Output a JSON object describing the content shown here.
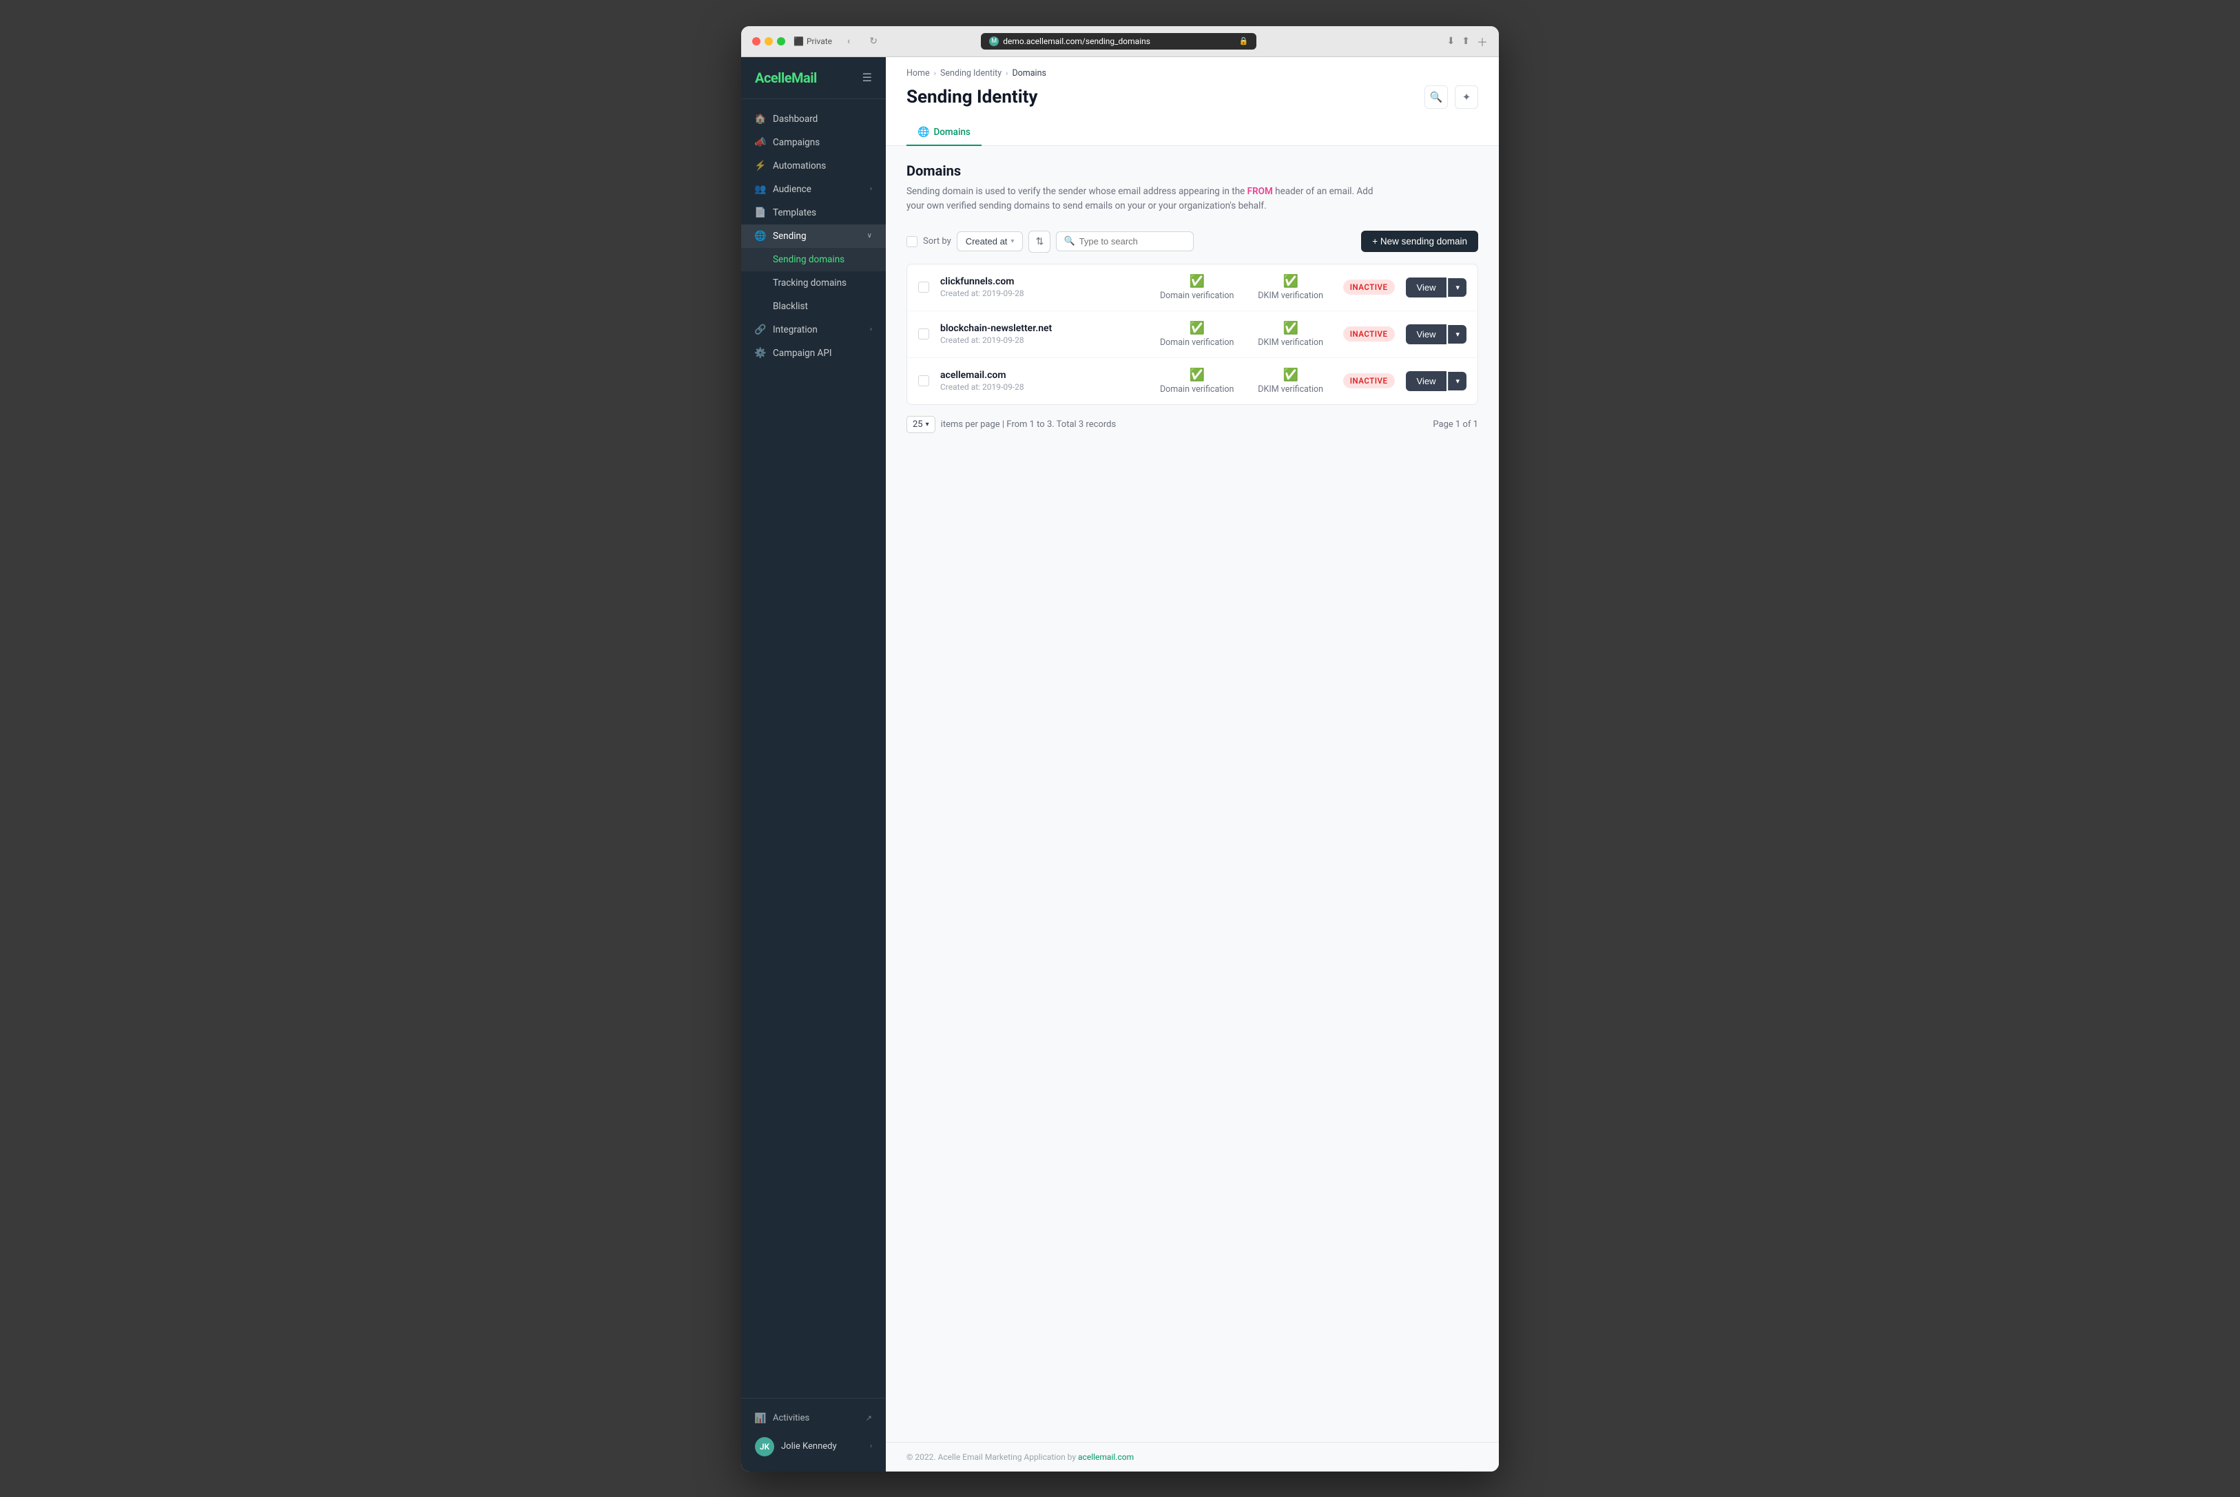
{
  "browser": {
    "url": "demo.acellemail.com/sending_domains",
    "private_label": "Private"
  },
  "logo": {
    "text1": "Acelle",
    "text2": "Mail"
  },
  "sidebar": {
    "nav_items": [
      {
        "id": "dashboard",
        "label": "Dashboard",
        "icon": "🏠",
        "active": false
      },
      {
        "id": "campaigns",
        "label": "Campaigns",
        "icon": "📣",
        "active": false
      },
      {
        "id": "automations",
        "label": "Automations",
        "icon": "⚡",
        "active": false
      },
      {
        "id": "audience",
        "label": "Audience",
        "icon": "👥",
        "active": false,
        "has_submenu": true
      },
      {
        "id": "templates",
        "label": "Templates",
        "icon": "📄",
        "active": false
      },
      {
        "id": "sending",
        "label": "Sending",
        "icon": "🌐",
        "active": true,
        "has_submenu": true
      }
    ],
    "submenu_items": [
      {
        "id": "sending-domains",
        "label": "Sending domains",
        "active": true
      },
      {
        "id": "tracking-domains",
        "label": "Tracking domains",
        "active": false
      },
      {
        "id": "blacklist",
        "label": "Blacklist",
        "active": false
      }
    ],
    "bottom_items": [
      {
        "id": "integration",
        "label": "Integration",
        "icon": "🔗",
        "has_submenu": true
      },
      {
        "id": "campaign-api",
        "label": "Campaign API",
        "icon": "⚙️",
        "active": false
      }
    ],
    "footer_items": [
      {
        "id": "activities",
        "label": "Activities",
        "icon": "📊"
      }
    ],
    "user": {
      "name": "Jolie Kennedy",
      "initials": "JK"
    }
  },
  "breadcrumb": {
    "items": [
      "Home",
      "Sending Identity",
      "Domains"
    ]
  },
  "page": {
    "title": "Sending Identity",
    "tabs": [
      {
        "id": "domains",
        "label": "Domains",
        "active": true
      }
    ]
  },
  "domains_section": {
    "title": "Domains",
    "description_part1": "Sending domain is used to verify the sender whose email address appearing in the ",
    "from_keyword": "FROM",
    "description_part2": " header of an email. Add your own verified sending domains to send emails on your or your organization's behalf.",
    "toolbar": {
      "sort_label": "Sort by",
      "sort_field": "Created at",
      "search_placeholder": "Type to search",
      "new_button_label": "+ New sending domain"
    },
    "domains": [
      {
        "name": "clickfunnels.com",
        "created_at": "Created at: 2019-09-28",
        "domain_verification": "Domain verification",
        "dkim_verification": "DKIM verification",
        "status": "INACTIVE"
      },
      {
        "name": "blockchain-newsletter.net",
        "created_at": "Created at: 2019-09-28",
        "domain_verification": "Domain verification",
        "dkim_verification": "DKIM verification",
        "status": "INACTIVE"
      },
      {
        "name": "acellemail.com",
        "created_at": "Created at: 2019-09-28",
        "domain_verification": "Domain verification",
        "dkim_verification": "DKIM verification",
        "status": "INACTIVE"
      }
    ],
    "pagination": {
      "per_page": "25",
      "summary": "items per page  |  From 1 to 3. Total 3 records",
      "page_info": "Page 1 of 1"
    },
    "view_btn_label": "View"
  },
  "footer": {
    "text": "© 2022. Acelle Email Marketing Application by ",
    "link_text": "acellemail.com",
    "link_url": "#"
  }
}
